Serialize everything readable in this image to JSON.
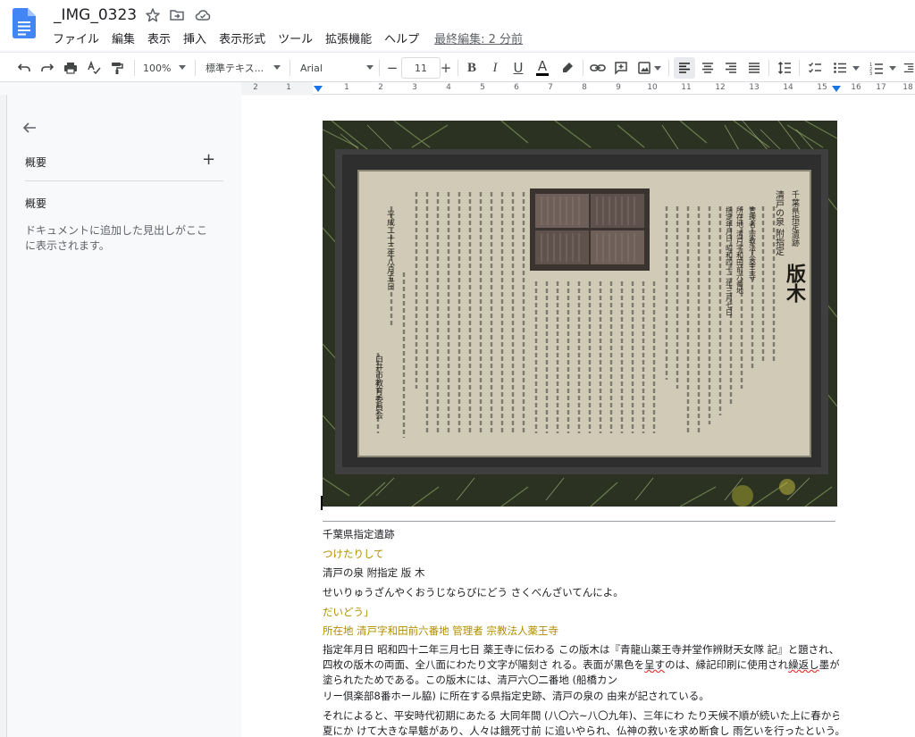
{
  "app": {
    "doc_title": "_IMG_0323",
    "menu": [
      "ファイル",
      "編集",
      "表示",
      "挿入",
      "表示形式",
      "ツール",
      "拡張機能",
      "ヘルプ"
    ],
    "last_edit": "最終編集: 2 分前"
  },
  "toolbar": {
    "zoom": "100%",
    "style": "標準テキス...",
    "font": "Arial",
    "minus": "−",
    "font_size": "11",
    "plus": "+",
    "bold": "B",
    "italic": "I",
    "underline": "U",
    "text_color": "A",
    "text_color_hex": "#000000"
  },
  "ruler": {
    "left_numbers": [
      "2",
      "1"
    ],
    "numbers": [
      "1",
      "2",
      "3",
      "4",
      "5",
      "6",
      "7",
      "8",
      "9",
      "10",
      "11",
      "12",
      "13",
      "14",
      "15",
      "16",
      "17",
      "18"
    ]
  },
  "outline": {
    "title": "概要",
    "add": "+",
    "subtitle": "概要",
    "hint": "ドキュメントに追加した見出しがここに表示されます。"
  },
  "sign": {
    "header": "千葉県指定遺跡",
    "title_small": "清戸の泉 附指定",
    "title_big": "版木",
    "info": [
      "所在地 清戸字和田前六番地",
      "管理者 宗教法人薬王寺",
      "指定年月日 昭和四十二年三月七日"
    ],
    "date": "平成二十三年八月五日",
    "issuer": "白井市教育委員会"
  },
  "document": {
    "p1": "千葉県指定遺跡",
    "p2": "つけたりして",
    "p3": "清戸の泉  附指定  版  木",
    "p4": "せいりゅうざんやくおうじならびにどう  さくべんざいてんによ。",
    "p5": "だいどう」",
    "p6": "所在地  清戸字和田前六番地  管理者  宗教法人薬王寺",
    "p7a": "指定年月日  昭和四十二年三月七日  薬王寺に伝わる  この版木は『青龍山薬王寺并堂作辨財天女隊  記』と題され、",
    "p7b": "四枚の版木の両面、全八面にわたり文字が陽刻さ  れる。表面が黒色を",
    "p7b_err": "呈す",
    "p7c": "のは、縁記印刷に使用され",
    "p7d_err": "繰返し",
    "p7e": "墨が",
    "p7f": "塗られたためである。この版木には、清戸六〇二番地 (船橋カン",
    "p8": "リー倶楽部8番ホール脇) に所在する県指定史跡、清戸の泉の  由来が記されている。",
    "p9a": "それによると、平安時代初期にあたる  大同年間 (八〇六~八〇九年)、三年にわ  たり天候不順が続いた上に春から",
    "p9b": "夏にか  けて大きな旱魃があり、人々は餓死寸前  に追いやられ、仏神の救いを求め断食し  雨乞いを行ったという。"
  }
}
